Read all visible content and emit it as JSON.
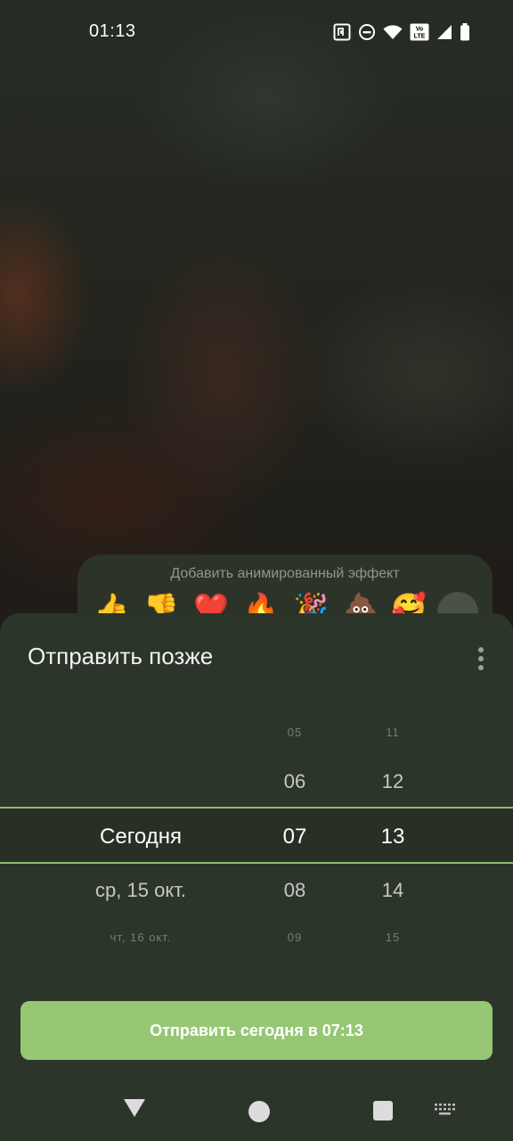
{
  "status_bar": {
    "time": "01:13",
    "icons": [
      "nfc-icon",
      "do-not-disturb-icon",
      "wifi-icon",
      "volte-icon",
      "signal-icon",
      "battery-icon"
    ],
    "volte_text": "Vo LTE"
  },
  "effect_panel": {
    "label": "Добавить анимированный эффект",
    "emojis": [
      "👍",
      "👎",
      "❤️",
      "🔥",
      "🎉",
      "💩",
      "🥰"
    ]
  },
  "sheet": {
    "title": "Отправить позже",
    "picker": {
      "days": {
        "far_above": "",
        "above": "",
        "selected": "Сегодня",
        "below": "ср, 15 окт.",
        "far_below": "чт, 16 окт."
      },
      "hours": {
        "far_above": "05",
        "above": "06",
        "selected": "07",
        "below": "08",
        "far_below": "09"
      },
      "minutes": {
        "far_above": "11",
        "above": "12",
        "selected": "13",
        "below": "14",
        "far_below": "15"
      }
    },
    "send_button_label": "Отправить сегодня в 07:13"
  },
  "colors": {
    "accent": "#97c775",
    "sheet_background": "#2c3529",
    "selection_line": "#8fb870"
  }
}
